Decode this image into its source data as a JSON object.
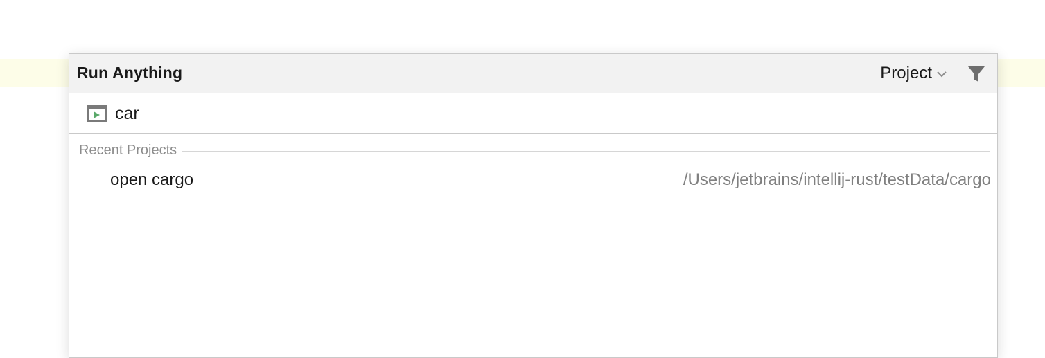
{
  "popup": {
    "title": "Run Anything",
    "scope": "Project",
    "filter_icon": "filter-icon",
    "chevron_icon": "chevron-down-icon"
  },
  "search": {
    "icon": "run-configuration-icon",
    "value": "car"
  },
  "sections": [
    {
      "label": "Recent Projects",
      "items": [
        {
          "label": "open cargo",
          "path": "/Users/jetbrains/intellij-rust/testData/cargo"
        }
      ]
    }
  ],
  "colors": {
    "header_bg": "#f2f2f2",
    "line_highlight": "#fdfde8",
    "run_icon_green": "#59a869",
    "muted_text": "#808080"
  }
}
